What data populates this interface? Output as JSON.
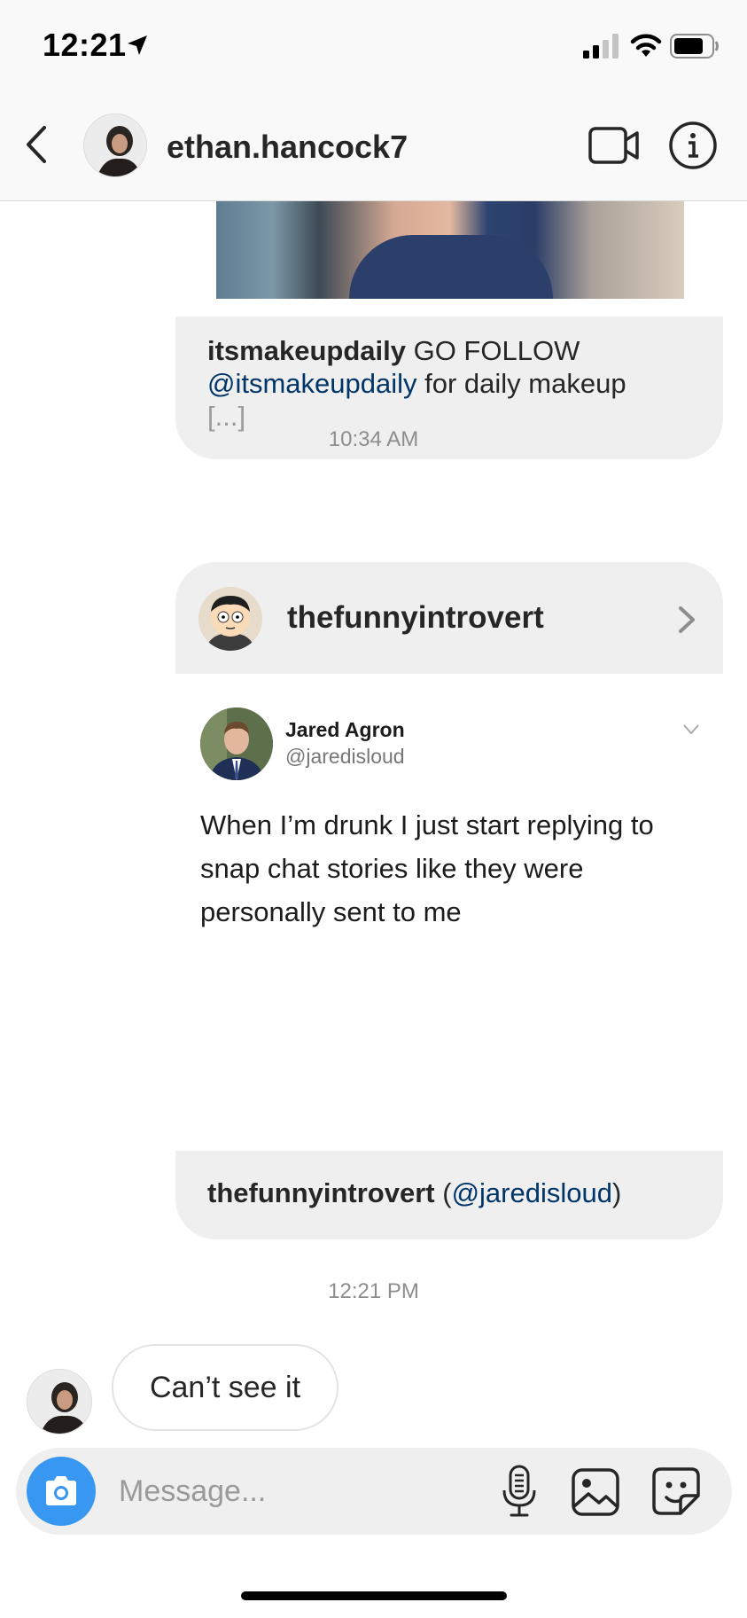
{
  "status_bar": {
    "time": "12:21",
    "icons": [
      "location-arrow-icon",
      "cellular-signal-icon",
      "wifi-icon",
      "battery-icon"
    ]
  },
  "header": {
    "username": "ethan.hancock7",
    "icons": [
      "back-chevron-icon",
      "video-call-icon",
      "info-icon"
    ]
  },
  "thread": {
    "shared_post_1": {
      "caption_user": "itsmakeupdaily",
      "caption_text_1": " GO FOLLOW ",
      "caption_mention": "@itsmakeupdaily",
      "caption_text_2": " for daily makeup",
      "caption_more": "[...]"
    },
    "timestamp_1": "10:34 AM",
    "shared_post_2": {
      "username": "thefunnyintrovert",
      "tweet": {
        "name": "Jared Agron",
        "handle": "@jaredisloud",
        "text": "When I’m drunk I just start replying to snap chat stories like they were personally sent to me"
      },
      "caption_user": "thefunnyintrovert",
      "caption_open": " (",
      "caption_mention": "@jaredisloud",
      "caption_close": ")"
    },
    "timestamp_2": "12:21 PM",
    "received_message": "Can’t see it"
  },
  "composer": {
    "placeholder": "Message...",
    "icons": [
      "camera-icon",
      "microphone-icon",
      "gallery-icon",
      "sticker-icon"
    ]
  },
  "colors": {
    "accent_blue": "#3897f0",
    "mention_blue": "#003569",
    "bubble_gray": "#efefef",
    "timestamp_gray": "#8e8e8e"
  }
}
